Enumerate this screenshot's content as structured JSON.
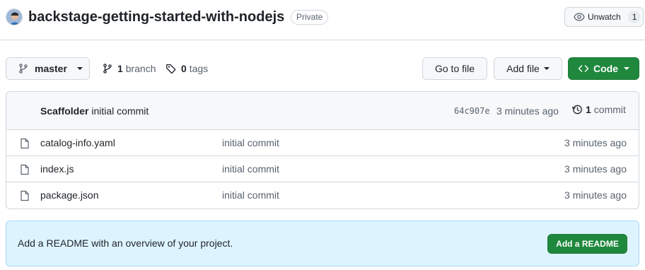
{
  "repo": {
    "name": "backstage-getting-started-with-nodejs",
    "visibility": "Private",
    "watch_label": "Unwatch",
    "watch_count": "1"
  },
  "toolbar": {
    "branch": "master",
    "branch_count": "1",
    "branch_label": "branch",
    "tag_count": "0",
    "tag_label": "tags",
    "goto_label": "Go to file",
    "addfile_label": "Add file",
    "code_label": "Code"
  },
  "latest_commit": {
    "author": "Scaffolder",
    "message": "initial commit",
    "sha": "64c907e",
    "time": "3 minutes ago",
    "commit_count": "1",
    "commit_label": "commit"
  },
  "files": [
    {
      "name": "catalog-info.yaml",
      "commit": "initial commit",
      "time": "3 minutes ago"
    },
    {
      "name": "index.js",
      "commit": "initial commit",
      "time": "3 minutes ago"
    },
    {
      "name": "package.json",
      "commit": "initial commit",
      "time": "3 minutes ago"
    }
  ],
  "readme": {
    "text": "Add a README with an overview of your project.",
    "button": "Add a README"
  },
  "colors": {
    "primary_green": "#1f883d",
    "banner_blue": "#ddf4ff",
    "border": "#d0d7de"
  }
}
